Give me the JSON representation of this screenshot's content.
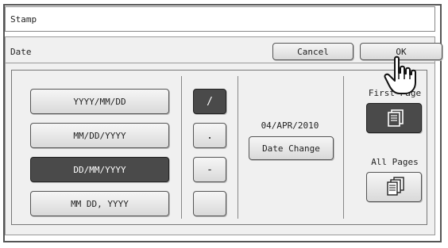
{
  "title": "Stamp",
  "section": "Date",
  "buttons": {
    "cancel": "Cancel",
    "ok": "OK",
    "date_change": "Date Change"
  },
  "formats": [
    "YYYY/MM/DD",
    "MM/DD/YYYY",
    "DD/MM/YYYY",
    "MM DD, YYYY"
  ],
  "selected_format_index": 2,
  "separators": [
    "/",
    ".",
    "-",
    ""
  ],
  "selected_separator_index": 0,
  "date_value": "04/APR/2010",
  "page_options": {
    "first": "First Page",
    "all": "All Pages"
  },
  "colors": {
    "selected": "#4a4a4a",
    "frame": "#555555",
    "panel": "#f0f0f0"
  },
  "icons": {
    "hand": "pointer-hand-icon",
    "pages": "stacked-pages-icon"
  }
}
